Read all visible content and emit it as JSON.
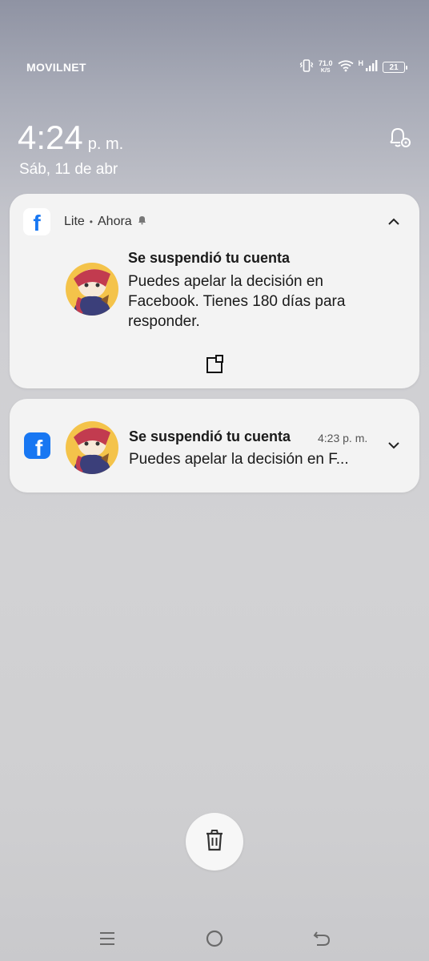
{
  "status_bar": {
    "carrier": "MOVILNET",
    "net_speed_value": "71.0",
    "net_speed_unit": "K/S",
    "network_type": "H",
    "battery_level": "21",
    "icons": [
      "vibrate-icon",
      "wifi-icon",
      "signal-icon",
      "battery-icon"
    ]
  },
  "lockscreen": {
    "time": "4:24",
    "ampm": "p. m.",
    "date": "Sáb, 11 de abr",
    "settings_icon": "bell-settings-icon"
  },
  "notifications": [
    {
      "app_name": "Lite",
      "separator": "•",
      "when": "Ahora",
      "title": "Se suspendió tu cuenta",
      "text": "Puedes apelar la decisión en Facebook. Tienes 180 días para responder.",
      "expanded": true,
      "icon": "facebook-lite-icon"
    },
    {
      "title": "Se suspendió tu cuenta",
      "time": "4:23 p. m.",
      "text": "Puedes apelar la decisión en F...",
      "expanded": false,
      "icon": "facebook-icon"
    }
  ],
  "colors": {
    "facebook_blue": "#1877f2",
    "card_bg": "#f3f3f3"
  },
  "actions": {
    "clear_all_icon": "trash-icon"
  },
  "nav": [
    "recents-icon",
    "home-icon",
    "back-icon"
  ]
}
